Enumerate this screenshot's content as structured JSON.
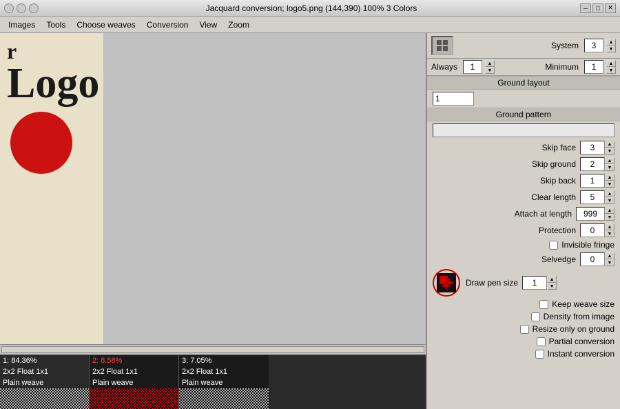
{
  "titlebar": {
    "title": "Jacquard conversion; logo5.png (144,390) 100% 3 Colors",
    "btn_close": "✕",
    "btn_min": "─",
    "btn_max": "□"
  },
  "menubar": {
    "items": [
      "Images",
      "Tools",
      "Choose weaves",
      "Conversion",
      "View",
      "Zoom"
    ]
  },
  "toolbar": {
    "icon": "⊞"
  },
  "right_panel": {
    "system_label": "System",
    "system_value": "3",
    "always_label": "Always",
    "always_value": "1",
    "minimum_label": "Minimum",
    "minimum_value": "1",
    "ground_layout_header": "Ground layout",
    "ground_layout_value": "1",
    "ground_pattern_header": "Ground pattern",
    "ground_pattern_value": "",
    "skip_face_label": "Skip face",
    "skip_face_value": "3",
    "skip_ground_label": "Skip ground",
    "skip_ground_value": "2",
    "skip_back_label": "Skip back",
    "skip_back_value": "1",
    "clear_length_label": "Clear length",
    "clear_length_value": "5",
    "attach_at_length_label": "Attach at length",
    "attach_at_length_value": "999",
    "protection_label": "Protection",
    "protection_value": "0",
    "invisible_fringe_label": "Invisible fringe",
    "selvedge_label": "Selvedge",
    "selvedge_value": "0",
    "draw_pen_size_label": "Draw pen size",
    "draw_pen_size_value": "1",
    "keep_weave_size_label": "Keep weave size",
    "density_from_image_label": "Density from image",
    "resize_only_on_ground_label": "Resize only on ground",
    "partial_conversion_label": "Partial conversion",
    "instant_conversion_label": "Instant conversion"
  },
  "swatches": [
    {
      "id": "1",
      "label": "1: 84.36%",
      "sub1": "2x2 Float 1x1",
      "sub2": "Plain weave",
      "color_class": "white"
    },
    {
      "id": "2",
      "label": "2: 8.58%",
      "sub1": "2x2 Float 1x1",
      "sub2": "Plain weave",
      "color_class": "red"
    },
    {
      "id": "3",
      "label": "3: 7.05%",
      "sub1": "2x2 Float 1x1",
      "sub2": "Plain weave",
      "color_class": "white"
    }
  ]
}
